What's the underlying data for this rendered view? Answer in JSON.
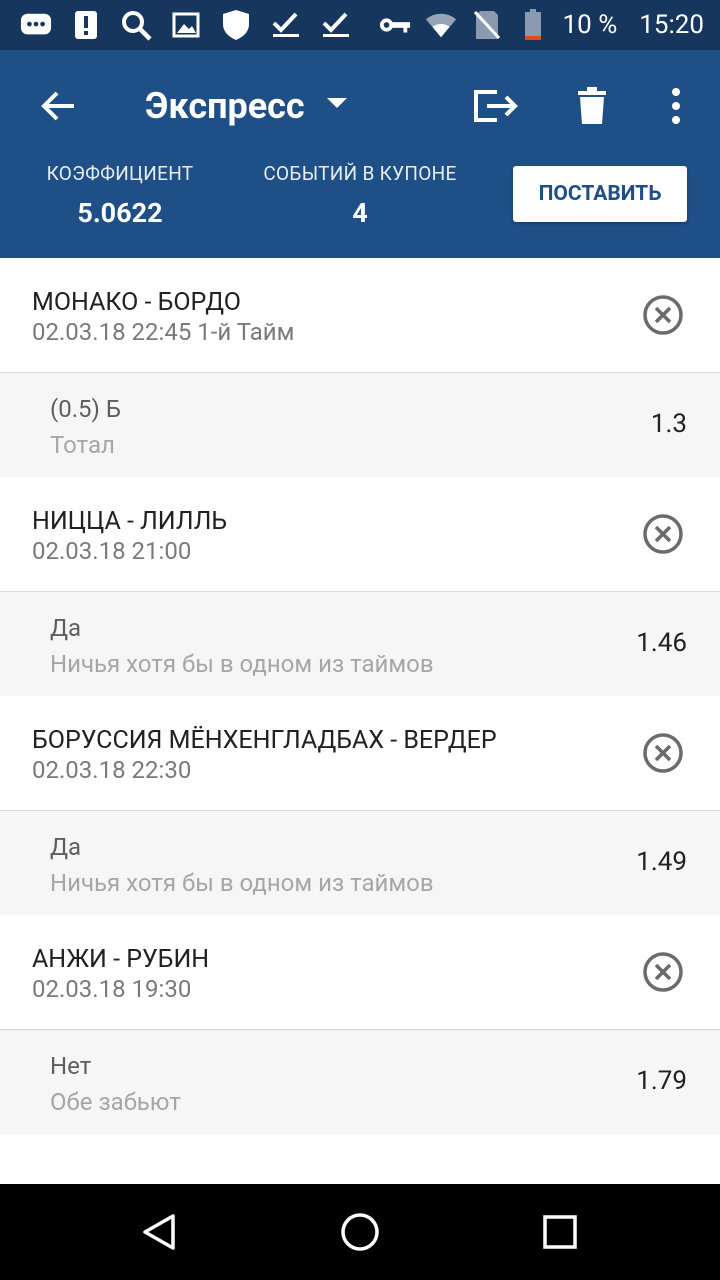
{
  "status_bar": {
    "battery": "10 %",
    "time": "15:20",
    "icons": [
      "chat-icon",
      "alert-icon",
      "search-icon",
      "image-icon",
      "shield-icon",
      "check-icon",
      "check-icon",
      "key-icon",
      "wifi-icon",
      "no-sim-icon",
      "battery-icon"
    ]
  },
  "header": {
    "title": "Экспресс",
    "coef_label": "КОЭФФИЦИЕНТ",
    "coef_value": "5.0622",
    "events_label": "СОБЫТИЙ В КУПОНЕ",
    "events_value": "4",
    "place_label": "ПОСТАВИТЬ"
  },
  "events": [
    {
      "title": "МОНАКО - БОРДО",
      "date": "02.03.18 22:45 1-й  Тайм",
      "bet_name": "(0.5) Б",
      "bet_market": "Тотал",
      "odd": "1.3"
    },
    {
      "title": "НИЦЦА - ЛИЛЛЬ",
      "date": "02.03.18 21:00",
      "bet_name": "Да",
      "bet_market": "Ничья хотя бы в одном из таймов",
      "odd": "1.46"
    },
    {
      "title": "БОРУССИЯ МЁНХЕНГЛАДБАХ - ВЕРДЕР",
      "date": "02.03.18 22:30",
      "bet_name": "Да",
      "bet_market": "Ничья хотя бы в одном из таймов",
      "odd": "1.49"
    },
    {
      "title": "АНЖИ - РУБИН",
      "date": "02.03.18 19:30",
      "bet_name": "Нет",
      "bet_market": "Обе забьют",
      "odd": "1.79"
    }
  ],
  "colors": {
    "status_bar": "#16365e",
    "app_bar": "#1f4f87",
    "bet_row_bg": "#f6f6f6"
  }
}
